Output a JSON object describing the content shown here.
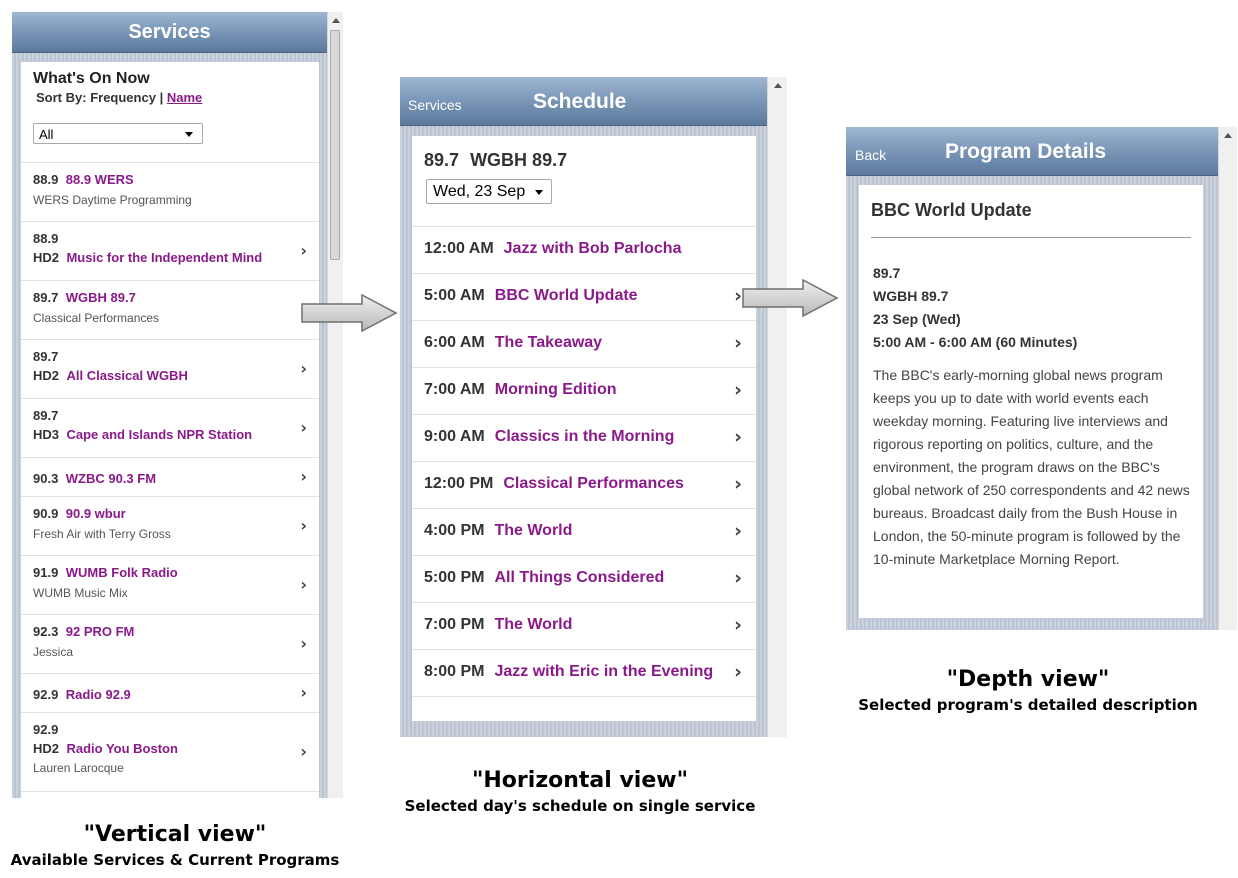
{
  "vertical": {
    "title": "Services",
    "heading": "What's On Now",
    "sort_label": "Sort By:",
    "sort_frequency": "Frequency",
    "sort_sep": "|",
    "sort_name": "Name",
    "filter_value": "All",
    "items": [
      {
        "freq": "88.9",
        "hd": "",
        "name": "88.9 WERS",
        "sub": "WERS Daytime Programming",
        "chevron": false
      },
      {
        "freq": "88.9",
        "hd": "HD2",
        "name": "Music for the Independent Mind",
        "sub": "",
        "chevron": true
      },
      {
        "freq": "89.7",
        "hd": "",
        "name": "WGBH 89.7",
        "sub": "Classical Performances",
        "chevron": true
      },
      {
        "freq": "89.7",
        "hd": "HD2",
        "name": "All Classical WGBH",
        "sub": "",
        "chevron": true
      },
      {
        "freq": "89.7",
        "hd": "HD3",
        "name": "Cape and Islands NPR Station",
        "sub": "",
        "chevron": true
      },
      {
        "freq": "90.3",
        "hd": "",
        "name": "WZBC 90.3 FM",
        "sub": "",
        "chevron": true
      },
      {
        "freq": "90.9",
        "hd": "",
        "name": "90.9 wbur",
        "sub": "Fresh Air with Terry Gross",
        "chevron": true
      },
      {
        "freq": "91.9",
        "hd": "",
        "name": "WUMB Folk Radio",
        "sub": "WUMB Music Mix",
        "chevron": true
      },
      {
        "freq": "92.3",
        "hd": "",
        "name": "92 PRO FM",
        "sub": "Jessica",
        "chevron": true
      },
      {
        "freq": "92.9",
        "hd": "",
        "name": "Radio 92.9",
        "sub": "",
        "chevron": true
      },
      {
        "freq": "92.9",
        "hd": "HD2",
        "name": "Radio You Boston",
        "sub": "Lauren Larocque",
        "chevron": true
      }
    ],
    "caption_title": "\"Vertical view\"",
    "caption_sub": "Available Services & Current Programs"
  },
  "horizontal": {
    "back_label": "Services",
    "title": "Schedule",
    "station_freq": "89.7",
    "station_name": "WGBH 89.7",
    "date_value": "Wed, 23 Sep",
    "items": [
      {
        "time": "12:00 AM",
        "program": "Jazz with Bob Parlocha",
        "chevron": false
      },
      {
        "time": "5:00 AM",
        "program": "BBC World Update",
        "chevron": true
      },
      {
        "time": "6:00 AM",
        "program": "The Takeaway",
        "chevron": true
      },
      {
        "time": "7:00 AM",
        "program": "Morning Edition",
        "chevron": true
      },
      {
        "time": "9:00 AM",
        "program": "Classics in the Morning",
        "chevron": true
      },
      {
        "time": "12:00 PM",
        "program": "Classical Performances",
        "chevron": true
      },
      {
        "time": "4:00 PM",
        "program": "The World",
        "chevron": true
      },
      {
        "time": "5:00 PM",
        "program": "All Things Considered",
        "chevron": true
      },
      {
        "time": "7:00 PM",
        "program": "The World",
        "chevron": true
      },
      {
        "time": "8:00 PM",
        "program": "Jazz with Eric in the Evening",
        "chevron": true
      }
    ],
    "caption_title": "\"Horizontal view\"",
    "caption_sub": "Selected day's schedule on single service"
  },
  "depth": {
    "back_label": "Back",
    "title": "Program Details",
    "program": "BBC World Update",
    "freq": "89.7",
    "station": "WGBH 89.7",
    "date": "23 Sep (Wed)",
    "time": "5:00 AM - 6:00 AM (60 Minutes)",
    "description": "The BBC's early-morning global news program keeps you up to date with world events each weekday morning. Featuring live interviews and rigorous reporting on politics, culture, and the environment, the program draws on the BBC's global network of 250 correspondents and 42 news bureaus. Broadcast daily from the Bush House in London, the 50-minute program is followed by the 10-minute Marketplace Morning Report.",
    "caption_title": "\"Depth view\"",
    "caption_sub": "Selected program's detailed description"
  },
  "colors": {
    "link_purple": "#8a1a8a",
    "titlebar_top": "#9fb7d2",
    "titlebar_bottom": "#5d7a9d"
  },
  "icons": [
    "chevron-right-icon",
    "flow-arrow-icon",
    "dropdown-caret-icon",
    "scroll-up-arrow-icon"
  ]
}
